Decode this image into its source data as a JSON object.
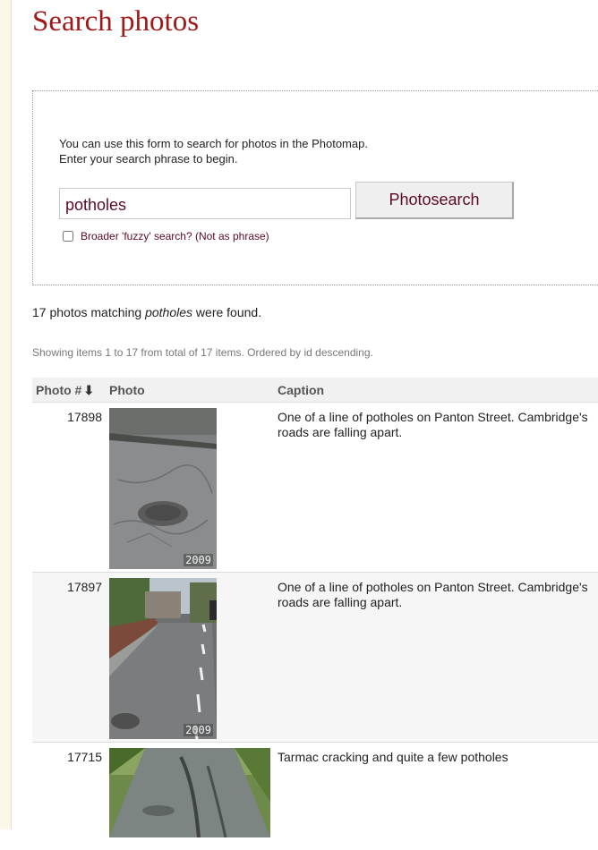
{
  "page": {
    "title": "Search photos"
  },
  "search": {
    "intro_line1": "You can use this form to search for photos in the Photomap.",
    "intro_line2": "Enter your search phrase to begin.",
    "query": "potholes",
    "button_label": "Photosearch",
    "fuzzy_label": "Broader 'fuzzy' search? (Not as phrase)",
    "fuzzy_checked": false
  },
  "results": {
    "count_prefix": "17 photos matching ",
    "count_term": "potholes",
    "count_suffix": " were found.",
    "showing": "Showing items 1 to 17 from total of 17 items. Ordered by id descending."
  },
  "table": {
    "headers": {
      "id": "Photo #",
      "sort_icon": "down-arrow-icon",
      "photo": "Photo",
      "caption": "Caption"
    },
    "rows": [
      {
        "id": "17898",
        "year": "2009",
        "caption": "One of a line of potholes on Panton Street. Cambridge's roads are falling apart.",
        "photo_kind": "portrait"
      },
      {
        "id": "17897",
        "year": "2009",
        "caption": "One of a line of potholes on Panton Street. Cambridge's roads are falling apart.",
        "photo_kind": "portrait"
      },
      {
        "id": "17715",
        "year": "",
        "caption": "Tarmac cracking and quite a few potholes",
        "photo_kind": "landscape"
      }
    ]
  },
  "colors": {
    "title": "#a01919",
    "accent_text": "#5c0a28",
    "gutter": "#fbf8ea"
  }
}
